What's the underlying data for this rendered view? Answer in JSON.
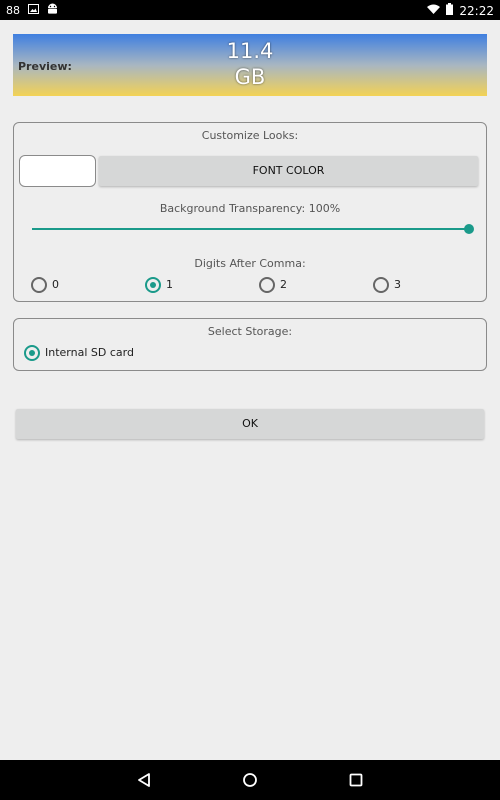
{
  "status_bar": {
    "notification_count": "88",
    "time": "22:22"
  },
  "preview": {
    "label": "Preview:",
    "value": "11.4",
    "unit": "GB",
    "gradient_colors": [
      "#3f7fe0",
      "#f3d255"
    ]
  },
  "customize": {
    "title": "Customize Looks:",
    "font_color_label": "FONT COLOR",
    "swatch_color": "#ffffff",
    "transparency_label": "Background Transparency: 100%",
    "transparency_value": 100,
    "digits_title": "Digits After Comma:",
    "digits_options": [
      "0",
      "1",
      "2",
      "3"
    ],
    "digits_selected": "1",
    "accent_color": "#1a9a8a"
  },
  "storage": {
    "title": "Select Storage:",
    "options": [
      "Internal SD card"
    ],
    "selected": "Internal SD card"
  },
  "ok_label": "OK",
  "nav": {
    "icons": [
      "back-icon",
      "home-icon",
      "recents-icon"
    ]
  }
}
